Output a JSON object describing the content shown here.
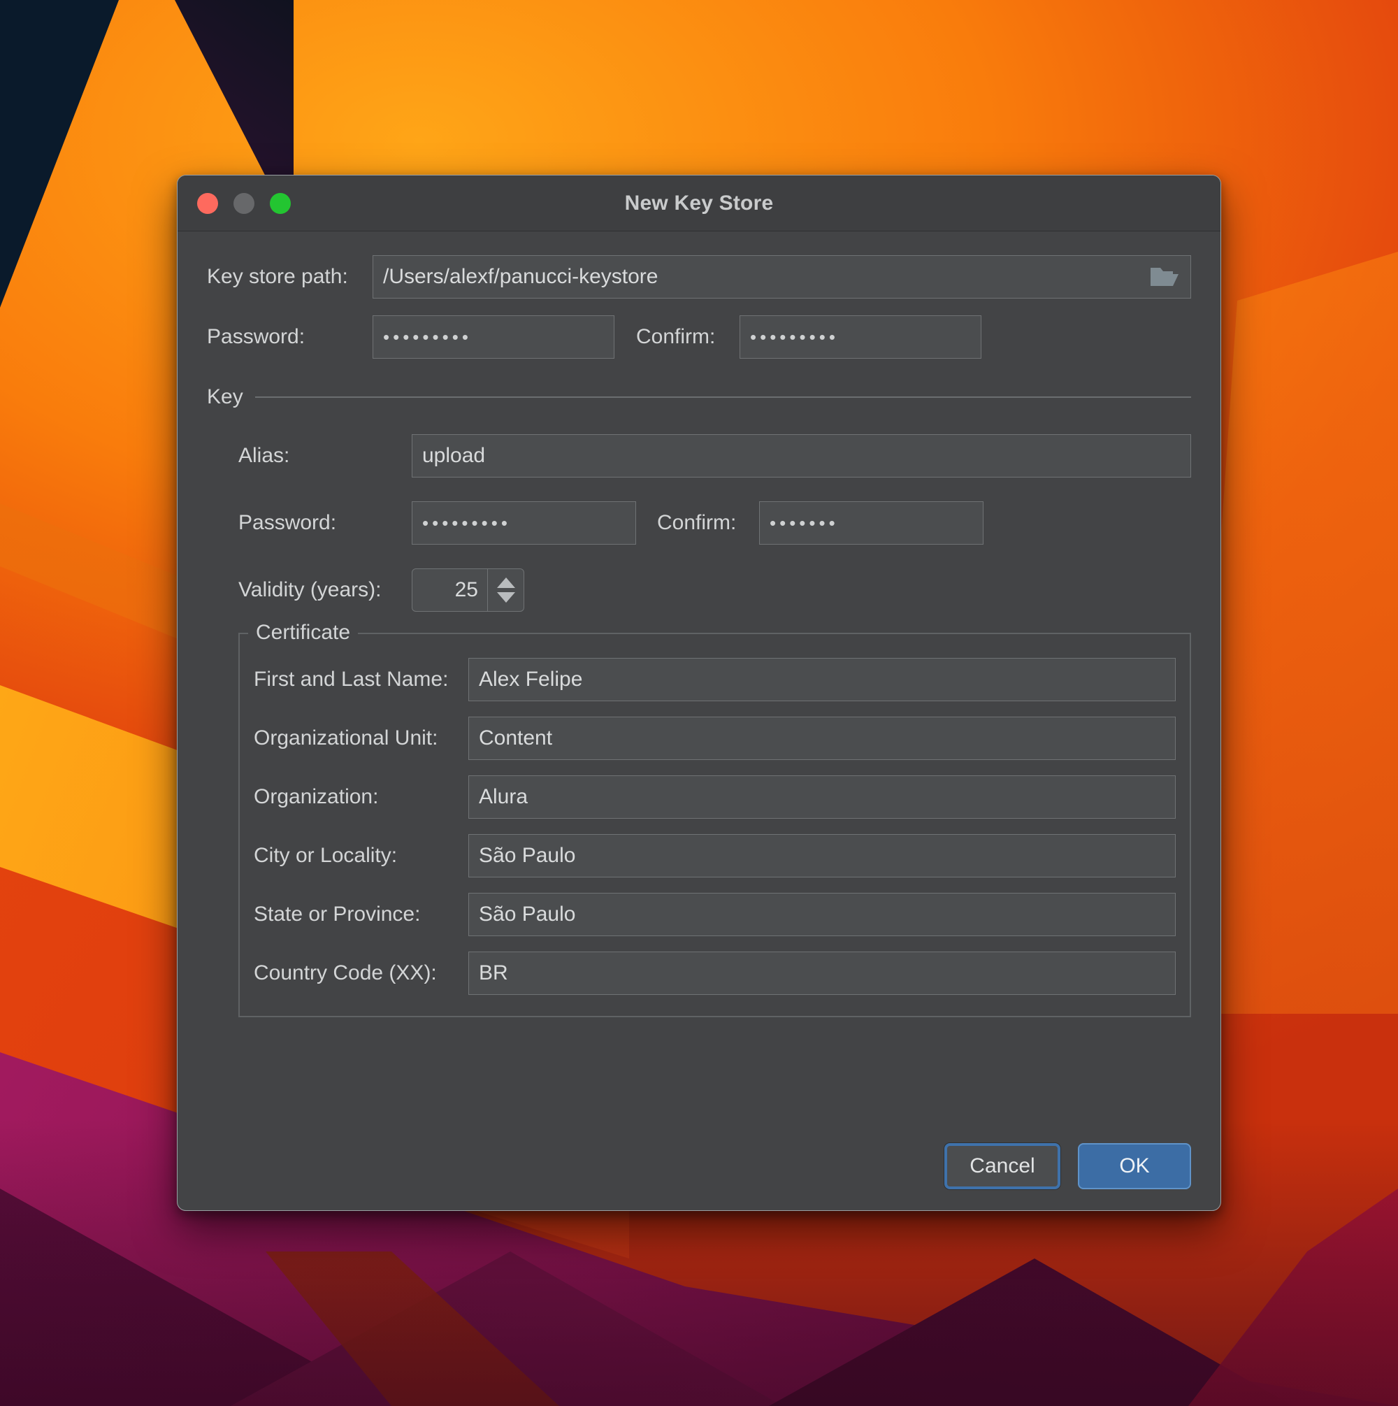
{
  "window": {
    "title": "New Key Store",
    "traffic_lights": [
      {
        "name": "close",
        "color": "#fe6a5e"
      },
      {
        "name": "minimize",
        "color": "#67686a"
      },
      {
        "name": "maximize",
        "color": "#23c531"
      }
    ]
  },
  "form": {
    "keystore_path": {
      "label": "Key store path:",
      "value": "/Users/alexf/panucci-keystore",
      "browse_icon": "open-folder-icon"
    },
    "store_password": {
      "label": "Password:",
      "value": "•••••••••"
    },
    "store_confirm": {
      "label": "Confirm:",
      "value": "•••••••••"
    }
  },
  "key_section": {
    "title": "Key",
    "alias": {
      "label": "Alias:",
      "value": "upload"
    },
    "password": {
      "label": "Password:",
      "value": "•••••••••"
    },
    "confirm": {
      "label": "Confirm:",
      "value": "•••••••"
    },
    "validity": {
      "label": "Validity (years):",
      "value": "25"
    }
  },
  "certificate": {
    "legend": "Certificate",
    "fields": [
      {
        "label": "First and Last Name:",
        "value": "Alex Felipe"
      },
      {
        "label": "Organizational Unit:",
        "value": "Content"
      },
      {
        "label": "Organization:",
        "value": "Alura"
      },
      {
        "label": "City or Locality:",
        "value": "São Paulo"
      },
      {
        "label": "State or Province:",
        "value": "São Paulo"
      },
      {
        "label": "Country Code (XX):",
        "value": "BR"
      }
    ]
  },
  "footer": {
    "cancel_label": "Cancel",
    "ok_label": "OK"
  },
  "colors": {
    "window_bg": "#434446",
    "titlebar_bg": "#3e3f41",
    "field_bg": "#4b4d4f",
    "field_border": "#6f7274",
    "text": "#d3d5d6",
    "accent_blue": "#3c6da5",
    "focus_ring": "#3f72ab"
  }
}
